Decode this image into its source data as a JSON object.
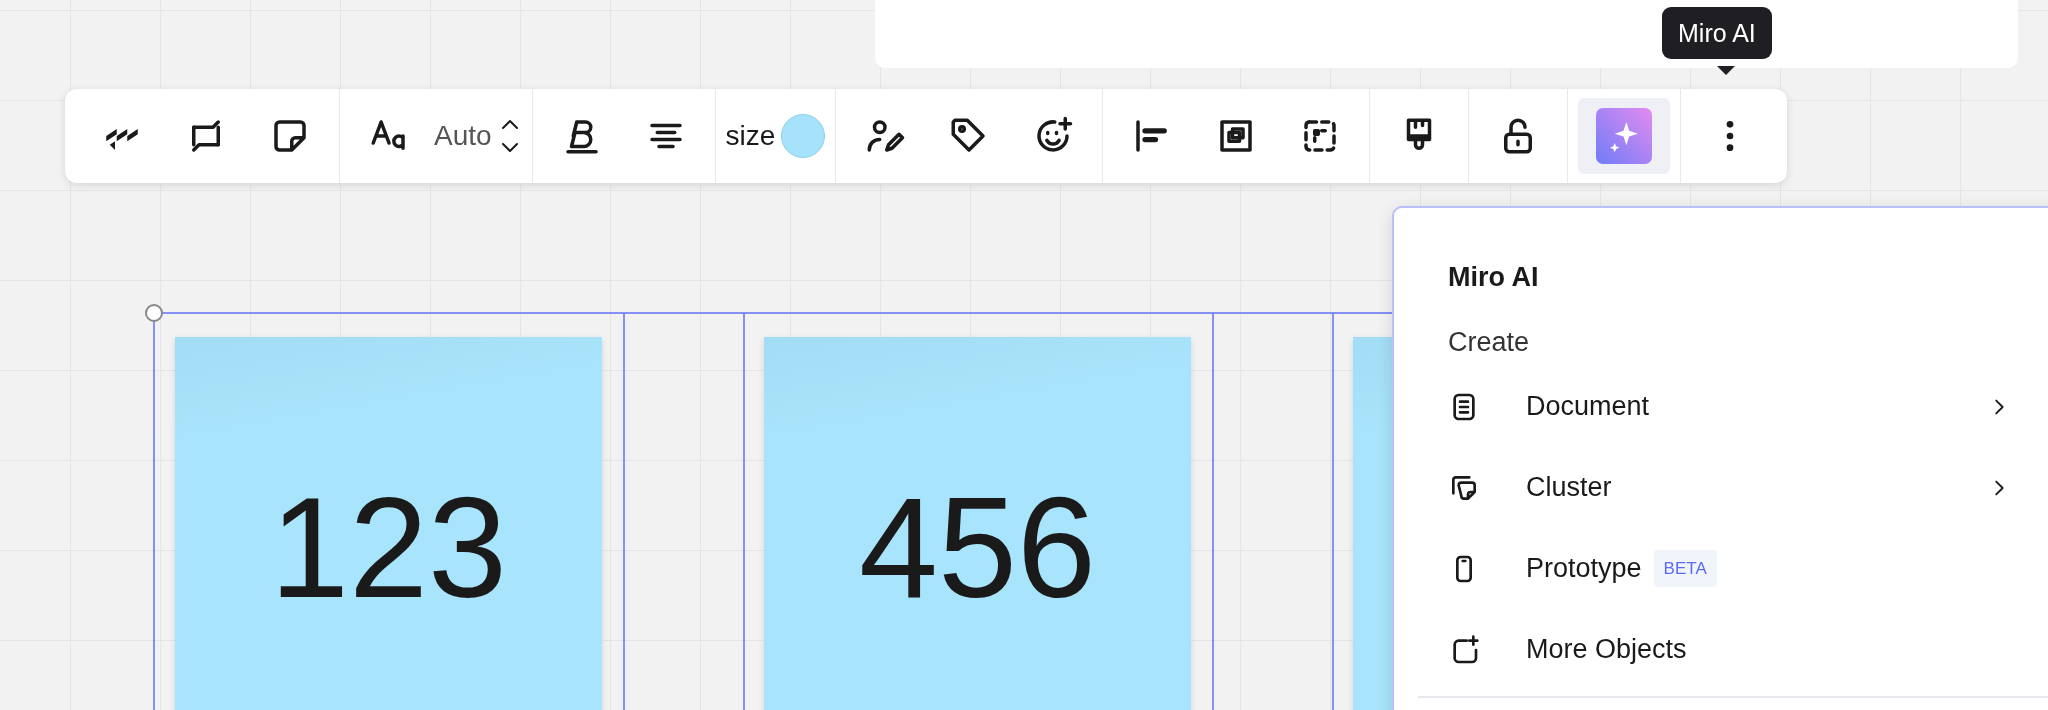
{
  "toolbar": {
    "groups": [
      {
        "items": [
          {
            "kind": "button",
            "selected": false
          },
          {
            "kind": "button",
            "selected": false
          },
          {
            "kind": "button",
            "selected": false
          }
        ]
      },
      {
        "items": [
          {
            "kind": "button",
            "selected": false
          },
          {
            "kind": "text",
            "text": "Auto"
          },
          {
            "kind": "stepper"
          }
        ]
      },
      {
        "items": [
          {
            "kind": "button",
            "selected": false
          },
          {
            "kind": "button",
            "selected": false
          }
        ]
      },
      {
        "items": [
          {
            "kind": "text",
            "text": "size"
          },
          {
            "kind": "swatch",
            "color": "#a6e3fb"
          }
        ]
      },
      {
        "items": [
          {
            "kind": "button",
            "selected": false
          },
          {
            "kind": "button",
            "selected": false
          },
          {
            "kind": "button",
            "selected": false
          }
        ]
      },
      {
        "items": [
          {
            "kind": "button",
            "selected": false
          },
          {
            "kind": "button",
            "selected": false
          },
          {
            "kind": "button",
            "selected": false
          }
        ]
      },
      {
        "items": [
          {
            "kind": "button",
            "selected": false
          }
        ]
      },
      {
        "items": [
          {
            "kind": "button",
            "selected": false
          }
        ]
      },
      {
        "items": [
          {
            "kind": "ai",
            "selected": true
          }
        ]
      },
      {
        "items": [
          {
            "kind": "button",
            "selected": false
          }
        ]
      }
    ]
  },
  "tooltip": "Miro AI",
  "menu": {
    "title": "Miro AI",
    "section": "Create",
    "items": [
      {
        "label": "Document",
        "submenu": true
      },
      {
        "label": "Cluster",
        "submenu": true
      },
      {
        "label": "Prototype",
        "submenu": false,
        "badge": "BETA"
      },
      {
        "label": "More Objects",
        "submenu": false
      }
    ]
  },
  "stickies": [
    {
      "kind": "note",
      "text": "123"
    },
    {
      "kind": "note",
      "text": "456"
    },
    {
      "kind": "note"
    }
  ]
}
